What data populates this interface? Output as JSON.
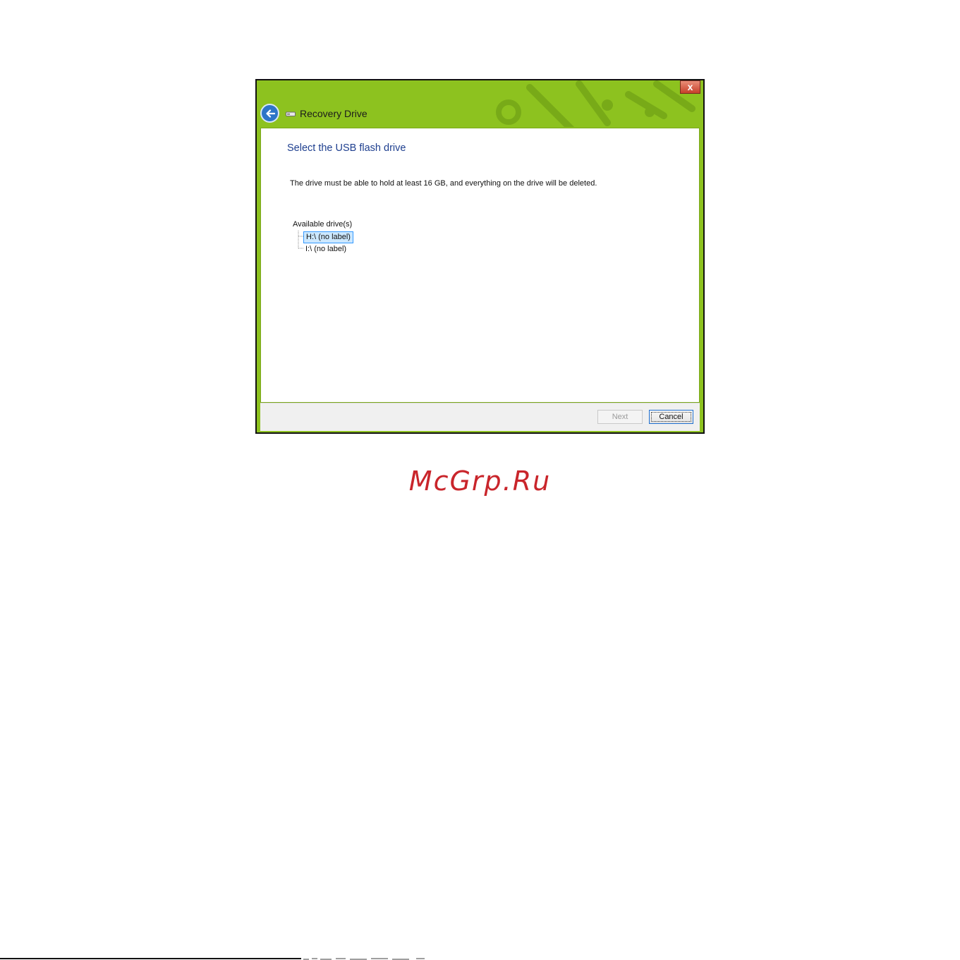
{
  "window": {
    "title": "Recovery Drive",
    "close_glyph": "x",
    "accent_color": "#8dc21f"
  },
  "icons": {
    "back": "back-arrow-icon",
    "drive": "drive-icon",
    "close": "close-icon"
  },
  "content": {
    "heading": "Select the USB flash drive",
    "description": "The drive must be able to hold at least 16 GB, and everything on the drive will be deleted.",
    "drives_label": "Available drive(s)",
    "drives": [
      {
        "label": "H:\\ (no label)",
        "selected": true
      },
      {
        "label": "I:\\ (no label)",
        "selected": false
      }
    ]
  },
  "footer": {
    "next_label": "Next",
    "next_enabled": false,
    "cancel_label": "Cancel"
  },
  "watermark": "McGrp.Ru"
}
